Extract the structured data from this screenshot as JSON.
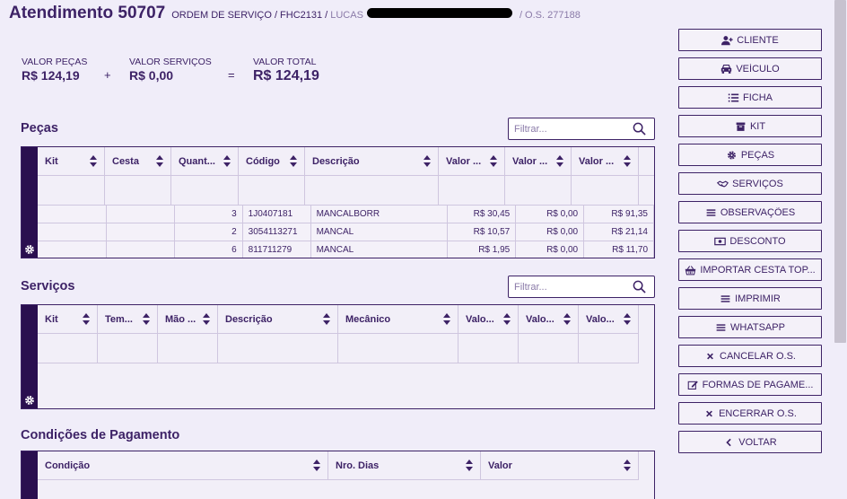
{
  "header": {
    "title": "Atendimento 50707",
    "subtitle": "ORDEM DE SERVIÇO / FHC2131 /",
    "user": "LUCAS",
    "os_number": "/ O.S. 277188"
  },
  "totals": {
    "pecas_label": "VALOR PEÇAS",
    "pecas_value": "R$ 124,19",
    "plus": "+",
    "servicos_label": "VALOR SERVIÇOS",
    "servicos_value": "R$ 0,00",
    "equals": "=",
    "total_label": "VALOR TOTAL",
    "total_value": "R$ 124,19"
  },
  "pecas": {
    "title": "Peças",
    "filter_placeholder": "Filtrar...",
    "columns": [
      "Kit",
      "Cesta",
      "Quant...",
      "Código",
      "Descrição",
      "Valor ...",
      "Valor ...",
      "Valor ..."
    ],
    "rows": [
      [
        "",
        "",
        "3",
        "1J0407181",
        "MANCALBORR",
        "R$ 30,45",
        "R$ 0,00",
        "R$ 91,35"
      ],
      [
        "",
        "",
        "2",
        "3054113271",
        "MANCAL",
        "R$ 10,57",
        "R$ 0,00",
        "R$ 21,14"
      ],
      [
        "",
        "",
        "6",
        "811711279",
        "MANCAL",
        "R$ 1,95",
        "R$ 0,00",
        "R$ 11,70"
      ]
    ]
  },
  "servicos": {
    "title": "Serviços",
    "filter_placeholder": "Filtrar...",
    "columns": [
      "Kit",
      "Tem...",
      "Mão ...",
      "Descrição",
      "Mecânico",
      "Valo...",
      "Valo...",
      "Valo..."
    ]
  },
  "pagamento": {
    "title": "Condições de Pagamento",
    "columns": [
      "Condição",
      "Nro. Dias",
      "Valor"
    ]
  },
  "sidebar": {
    "buttons": [
      {
        "label": "CLIENTE",
        "icon": "user-plus-icon"
      },
      {
        "label": "VEÍCULO",
        "icon": "car-icon"
      },
      {
        "label": "FICHA",
        "icon": "list-icon"
      },
      {
        "label": "KIT",
        "icon": "archive-icon"
      },
      {
        "label": "PEÇAS",
        "icon": "gear-icon"
      },
      {
        "label": "SERVIÇOS",
        "icon": "handshake-icon"
      },
      {
        "label": "OBSERVAÇÕES",
        "icon": "bars-icon"
      },
      {
        "label": "DESCONTO",
        "icon": "money-icon"
      },
      {
        "label": "IMPORTAR CESTA TOP...",
        "icon": "basket-icon"
      },
      {
        "label": "IMPRIMIR",
        "icon": "bars-icon"
      },
      {
        "label": "WHATSAPP",
        "icon": "bars-icon"
      },
      {
        "label": "CANCELAR O.S.",
        "icon": "close-icon"
      },
      {
        "label": "FORMAS DE PAGAME...",
        "icon": "edit-icon"
      },
      {
        "label": "ENCERRAR O.S.",
        "icon": "close-icon"
      },
      {
        "label": "VOLTAR",
        "icon": "chevron-left-icon"
      }
    ]
  },
  "colors": {
    "primary": "#3d2266",
    "rail": "#2a0f4f",
    "background": "#f0edf9"
  }
}
